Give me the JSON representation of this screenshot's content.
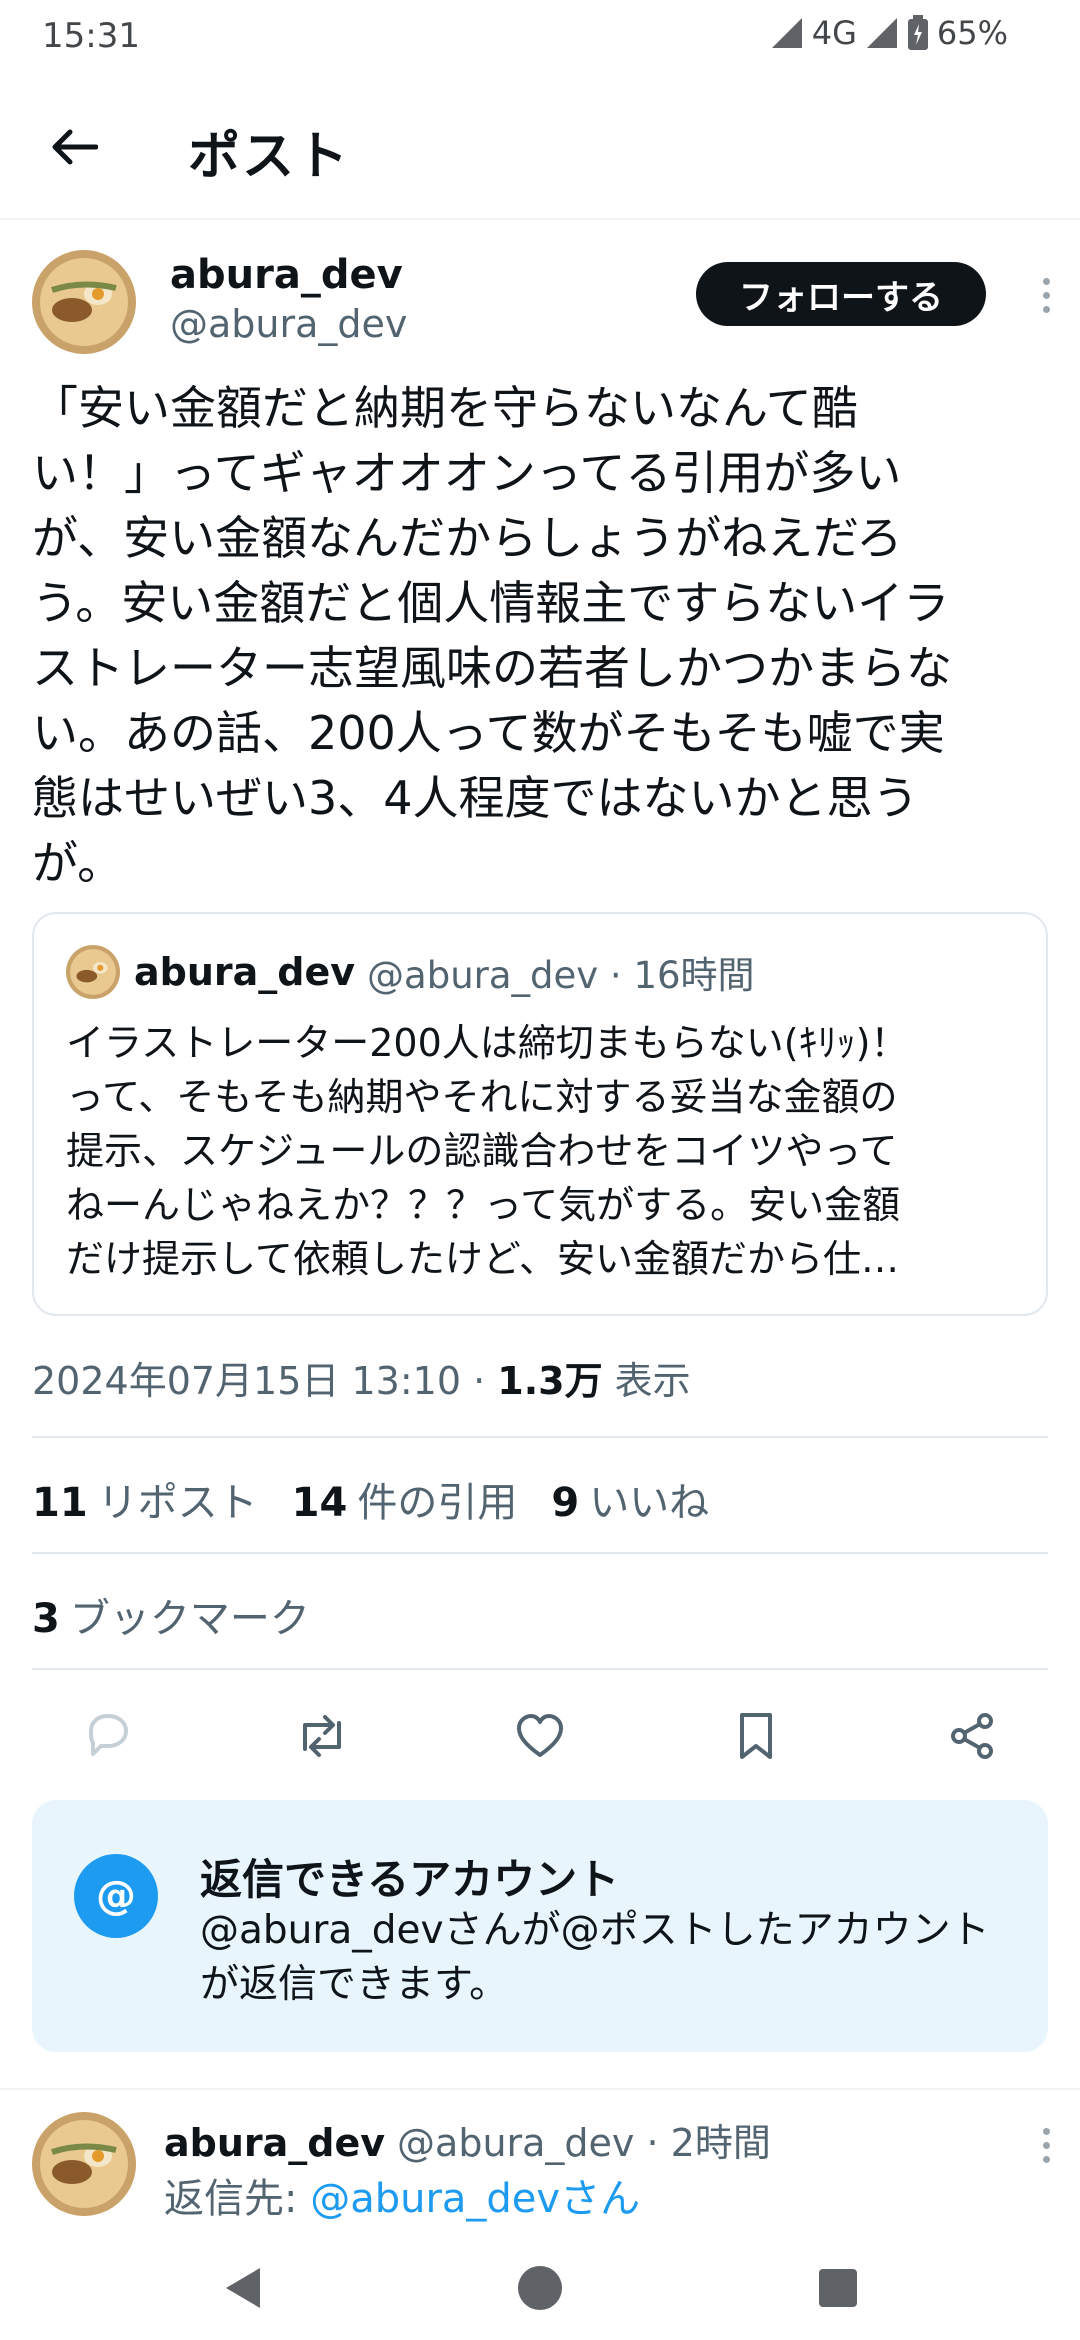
{
  "status_bar": {
    "time": "15:31",
    "network": "4G",
    "battery": "65%"
  },
  "header": {
    "title": "ポスト"
  },
  "post": {
    "author_name": "abura_dev",
    "author_handle": "@abura_dev",
    "follow_label": "フォローする",
    "text": "「安い金額だと納期を守らないなんて酷\nい！」ってギャオオオンってる引用が多い\nが、安い金額なんだからしょうがねえだろ\nう。安い金額だと個人情報主ですらないイラ\nストレーター志望風味の若者しかつかまらな\nい。あの話、200人って数がそもそも嘘で実\n態はせいぜい3、4人程度ではないかと思う\nが。",
    "timestamp": "2024年07月15日 13:10 · ",
    "views_count": "1.3万",
    "views_label": " 表示"
  },
  "quote": {
    "author_name": "abura_dev",
    "meta": "@abura_dev · 16時間",
    "text": "イラストレーター200人は締切まもらない(ｷﾘｯ)！\nって、そもそも納期やそれに対する妥当な金額の\n提示、スケジュールの認識合わせをコイツやって\nねーんじゃねえか？？？って気がする。安い金額\nだけ提示して依頼したけど、安い金額だから仕…"
  },
  "stats": {
    "reposts_count": "11",
    "reposts_label": "リポスト",
    "quotes_count": "14",
    "quotes_label": "件の引用",
    "likes_count": "9",
    "likes_label": "いいね",
    "bookmarks_count": "3",
    "bookmarks_label": "ブックマーク"
  },
  "actions": [
    "reply-icon",
    "repost-icon",
    "like-icon",
    "bookmark-icon",
    "share-icon"
  ],
  "reply_restriction": {
    "icon": "@",
    "title": "返信できるアカウント",
    "description": "@abura_devさんが@ポストしたアカウントが返信できます。"
  },
  "reply_post": {
    "author_name": "abura_dev",
    "meta": "@abura_dev · 2時間",
    "reply_to_label": "返信先: ",
    "reply_to_mention": "@abura_devさん"
  },
  "colors": {
    "accent": "#1d9bf0",
    "text": "#0f1419",
    "muted": "#536471",
    "reply_box_bg": "#e8f5fd"
  }
}
